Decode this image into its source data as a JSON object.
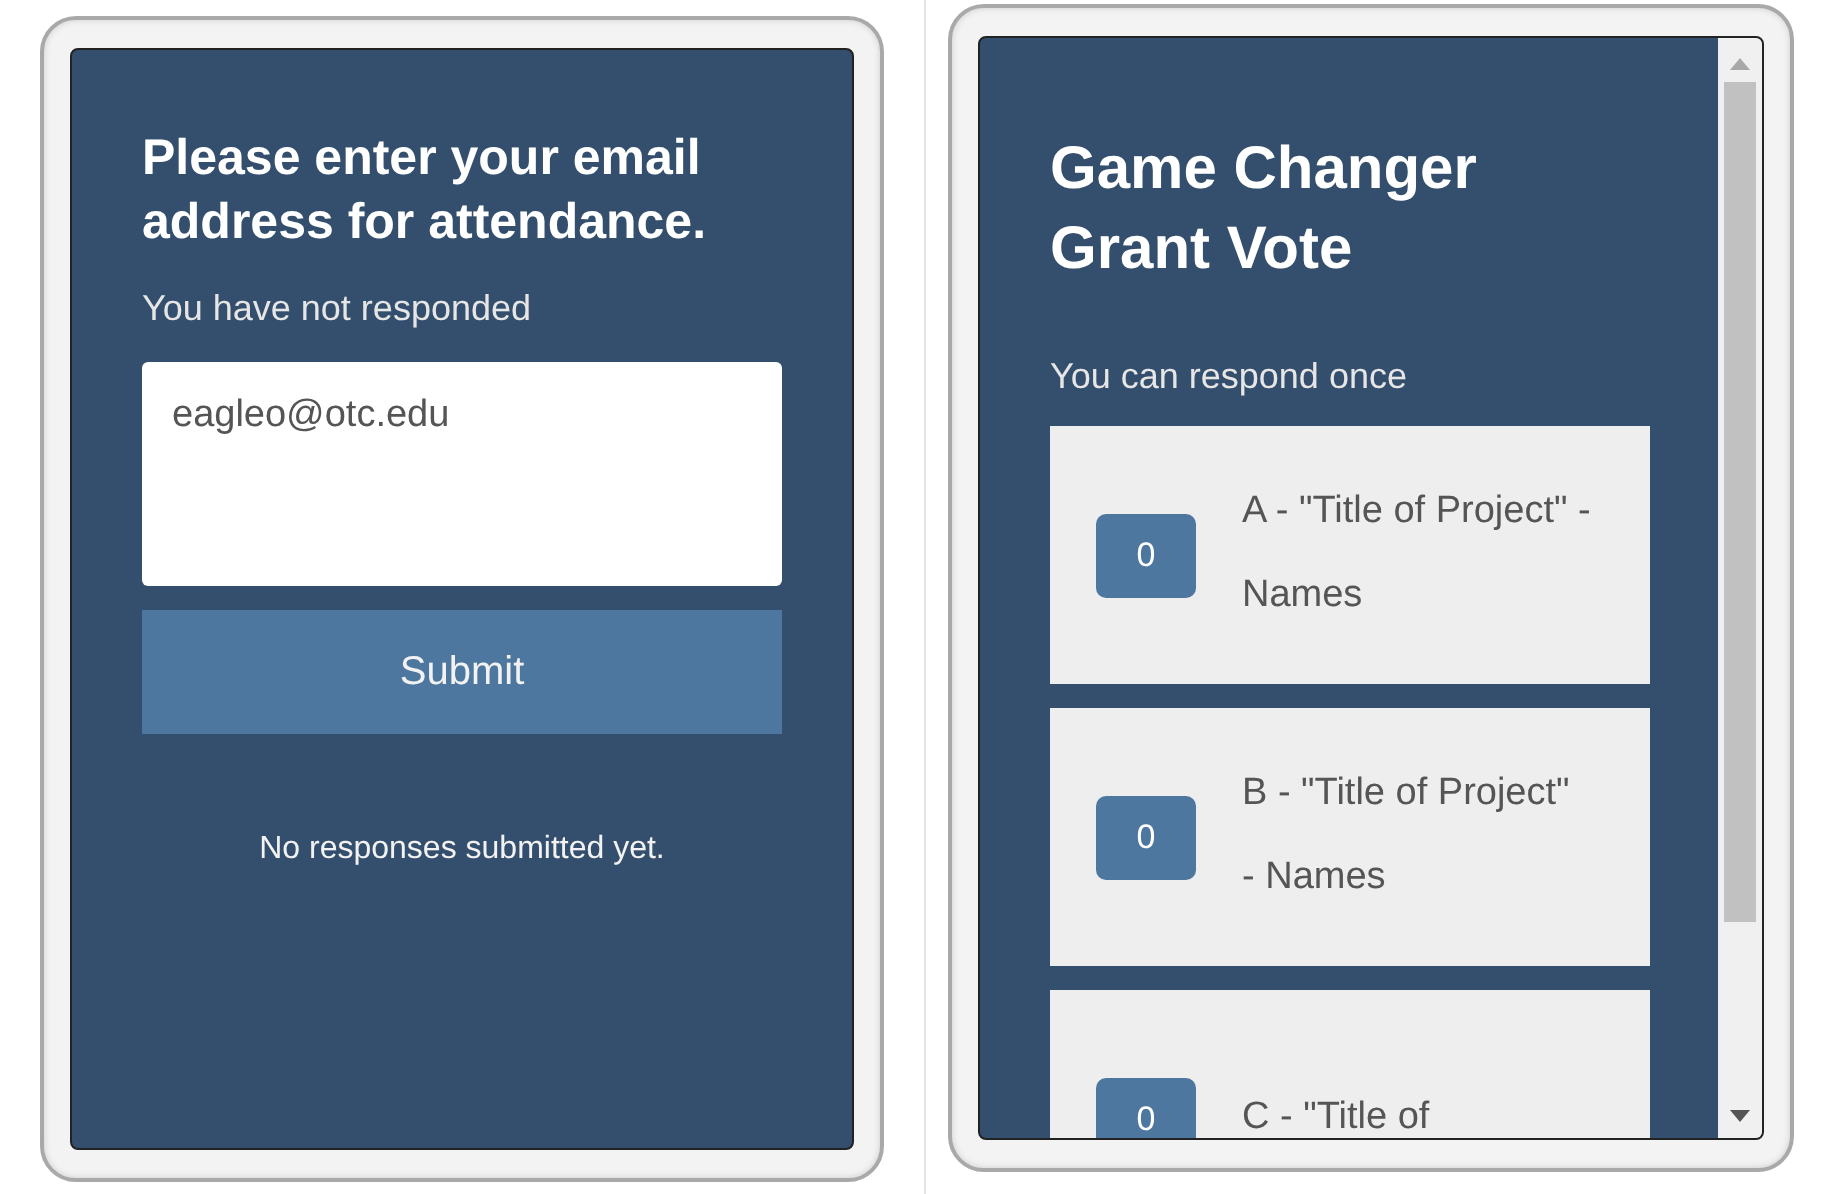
{
  "attendance_panel": {
    "title": "Please enter your email address for attendance.",
    "status": "You have not responded",
    "email_field": {
      "value": "eagleo@otc.edu"
    },
    "submit_button": "Submit",
    "footer": "No responses submitted yet."
  },
  "vote_panel": {
    "title": "Game Changer Grant Vote",
    "status": "You can respond once",
    "options": [
      {
        "count": "0",
        "label": "A - \"Title of Project\" - Names"
      },
      {
        "count": "0",
        "label": "B - \"Title of Project\" - Names"
      },
      {
        "count": "0",
        "label": "C - \"Title of"
      }
    ]
  }
}
